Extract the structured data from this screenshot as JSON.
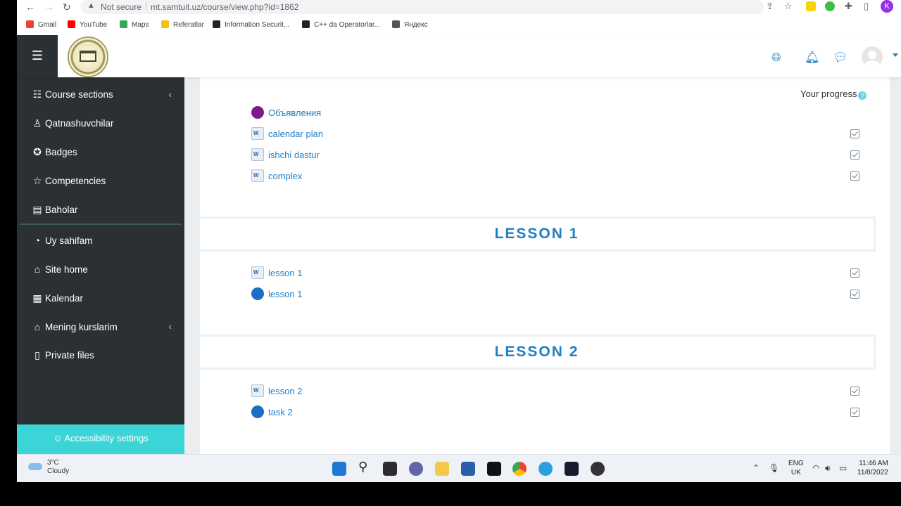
{
  "browser": {
    "security_label": "Not secure",
    "url": "mt.samtuit.uz/course/view.php?id=1862",
    "profile_initial": "K",
    "bookmarks": [
      {
        "label": "Gmail",
        "color": "#ea4335"
      },
      {
        "label": "YouTube",
        "color": "#ff0000"
      },
      {
        "label": "Maps",
        "color": "#34a853"
      },
      {
        "label": "Referatlar",
        "color": "#f4c20d"
      },
      {
        "label": "Information Securit...",
        "color": "#222222"
      },
      {
        "label": "C++ da Operatorlar...",
        "color": "#222222"
      },
      {
        "label": "Яндекс",
        "color": "#555555"
      }
    ]
  },
  "drawer": {
    "items": [
      {
        "label": "Course sections",
        "icon": "list-icon"
      },
      {
        "label": "Qatnashuvchilar",
        "icon": "users-icon"
      },
      {
        "label": "Badges",
        "icon": "badge-icon"
      },
      {
        "label": "Competencies",
        "icon": "star-icon"
      },
      {
        "label": "Baholar",
        "icon": "book-icon"
      },
      {
        "label": "Uy sahifam",
        "icon": "dashboard-icon"
      },
      {
        "label": "Site home",
        "icon": "home-icon"
      },
      {
        "label": "Kalendar",
        "icon": "calendar-icon"
      },
      {
        "label": "Mening kurslarim",
        "icon": "graduation-cap-icon"
      },
      {
        "label": "Private files",
        "icon": "file-icon"
      }
    ],
    "accessibility": "Accessibility settings"
  },
  "main": {
    "progress_label": "Your progress",
    "general": [
      {
        "label": "Объявления",
        "type": "forum"
      },
      {
        "label": "calendar plan",
        "type": "doc",
        "done": true
      },
      {
        "label": "ishchi dastur",
        "type": "doc",
        "done": true
      },
      {
        "label": "complex",
        "type": "doc",
        "done": true
      }
    ],
    "sections": [
      {
        "title": "LESSON 1",
        "activities": [
          {
            "label": "lesson 1",
            "type": "doc",
            "done": true
          },
          {
            "label": "lesson 1",
            "type": "assign",
            "done": true
          }
        ]
      },
      {
        "title": "LESSON 2",
        "activities": [
          {
            "label": "lesson 2",
            "type": "doc",
            "done": true
          },
          {
            "label": "task 2",
            "type": "assign",
            "done": true
          }
        ]
      }
    ]
  },
  "taskbar": {
    "temperature": "3°C",
    "condition": "Cloudy",
    "lang": "ENG",
    "region": "UK",
    "time": "11:46 AM",
    "date": "11/8/2022"
  }
}
